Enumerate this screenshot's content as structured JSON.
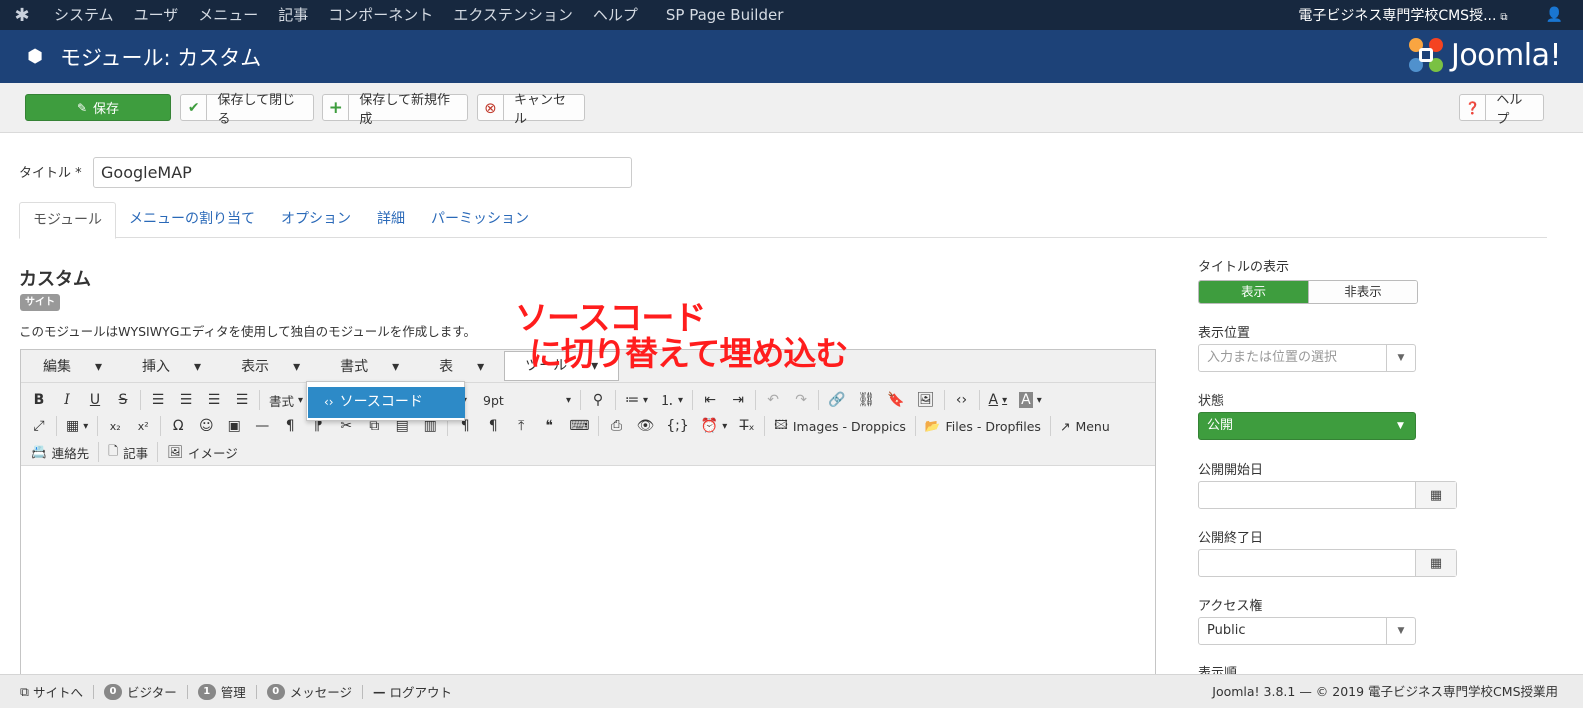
{
  "topnav": {
    "menu": [
      "システム",
      "ユーザ",
      "メニュー",
      "記事",
      "コンポーネント",
      "エクステンション",
      "ヘルプ"
    ],
    "extra": "SP Page Builder",
    "site_name": "電子ビジネス専門学校CMS授...",
    "icons": [
      "joomla-icon",
      "external-link-icon",
      "user-icon"
    ]
  },
  "header": {
    "title": "モジュール: カスタム",
    "brand": "Joomla!"
  },
  "toolbar": {
    "save": "保存",
    "save_close": "保存して閉じる",
    "save_new": "保存して新規作成",
    "cancel": "キャンセル",
    "help": "ヘルプ"
  },
  "form": {
    "title_label": "タイトル *",
    "title_value": "GoogleMAP",
    "tabs": [
      "モジュール",
      "メニューの割り当て",
      "オプション",
      "詳細",
      "パーミッション"
    ],
    "module_heading": "カスタム",
    "badge": "サイト",
    "description": "このモジュールはWYSIWYGエディタを使用して独自のモジュールを作成します。"
  },
  "annotation": {
    "line1": "ソースコード",
    "line2": "に切り替えて埋め込む",
    "color": "#ff1d1d"
  },
  "editor": {
    "menubar": [
      "編集",
      "挿入",
      "表示",
      "書式",
      "表",
      "ツール"
    ],
    "dropdown_item": "ソースコード",
    "format_label": "書式",
    "font_partial": "a",
    "font_size": "9pt",
    "images_btn": "Images - Droppics",
    "files_btn": "Files - Dropfiles",
    "menu_btn": "Menu",
    "contact_btn": "連絡先",
    "article_btn": "記事",
    "image_btn": "イメージ"
  },
  "sidebar": {
    "show_title_label": "タイトルの表示",
    "show": "表示",
    "hide": "非表示",
    "position_label": "表示位置",
    "position_placeholder": "入力または位置の選択",
    "status_label": "状態",
    "status_value": "公開",
    "start_label": "公開開始日",
    "end_label": "公開終了日",
    "access_label": "アクセス権",
    "access_value": "Public",
    "order_label": "表示順"
  },
  "statusbar": {
    "site": "サイトへ",
    "visitors_count": "0",
    "visitors": "ビジター",
    "admin_count": "1",
    "admin": "管理",
    "messages_count": "0",
    "messages": "メッセージ",
    "logout": "ログアウト",
    "footer": "Joomla! 3.8.1 — © 2019 電子ビジネス専門学校CMS授業用"
  },
  "colors": {
    "topnav": "#17283f",
    "header": "#1d4278",
    "success": "#3e9d3e",
    "link": "#2a69b8",
    "highlight": "#2d8ac7"
  }
}
